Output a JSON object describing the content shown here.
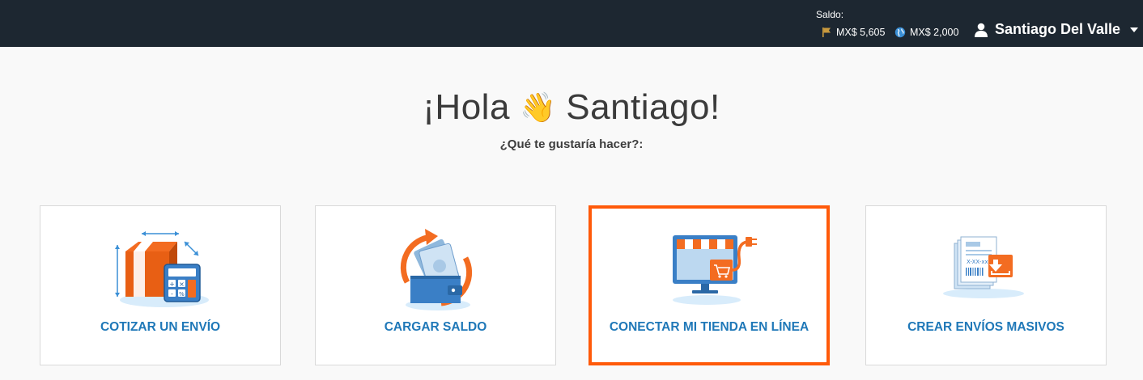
{
  "header": {
    "saldo_label": "Saldo:",
    "balances": [
      {
        "icon": "flag-icon",
        "value": "MX$ 5,605"
      },
      {
        "icon": "globe-icon",
        "value": "MX$ 2,000"
      }
    ],
    "user_name": "Santiago Del Valle"
  },
  "hero": {
    "greeting_pre": "¡Hola",
    "greeting_emoji": "👋",
    "greeting_post": "Santiago!",
    "subtitle": "¿Qué te gustaría hacer?:"
  },
  "cards": [
    {
      "label": "COTIZAR UN ENVÍO",
      "icon": "box-calculator-icon"
    },
    {
      "label": "CARGAR SALDO",
      "icon": "wallet-refresh-icon"
    },
    {
      "label": "CONECTAR MI TIENDA EN LÍNEA",
      "icon": "online-store-icon",
      "highlighted": true
    },
    {
      "label": "CREAR ENVÍOS MASIVOS",
      "icon": "bulk-labels-icon"
    }
  ],
  "colors": {
    "topbar": "#1d2731",
    "accent_orange": "#ff5a0a",
    "link_blue": "#1f78b8",
    "flag_gold": "#c99a3e",
    "globe_blue": "#3a8fd6"
  }
}
